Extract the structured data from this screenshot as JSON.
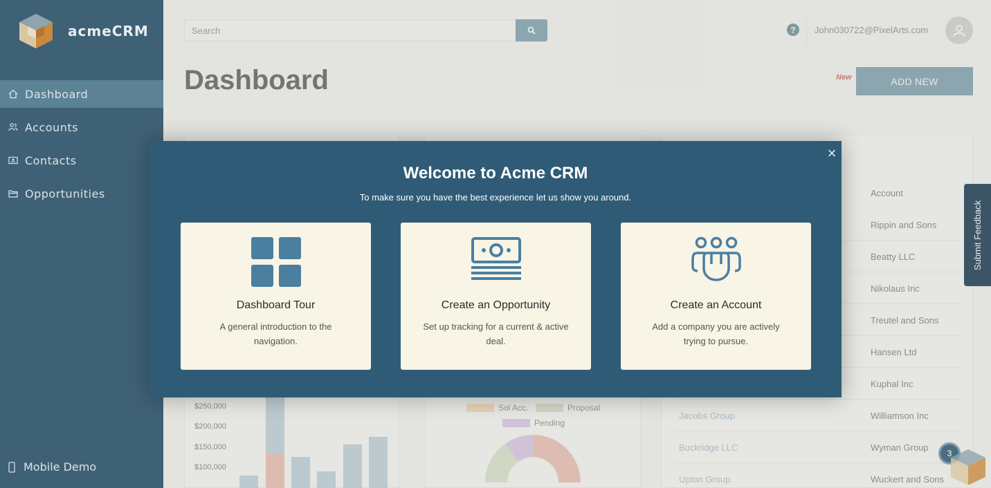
{
  "app": {
    "name": "acmeCRM"
  },
  "sidebar": {
    "items": [
      {
        "label": "Dashboard",
        "icon": "home-icon",
        "active": true
      },
      {
        "label": "Accounts",
        "icon": "users-icon",
        "active": false
      },
      {
        "label": "Contacts",
        "icon": "contact-card-icon",
        "active": false
      },
      {
        "label": "Opportunities",
        "icon": "folder-icon",
        "active": false
      }
    ],
    "mobile_demo": "Mobile Demo"
  },
  "topbar": {
    "search_placeholder": "Search",
    "user_email": "John030722@PixelArts.com",
    "help_icon": "?"
  },
  "header": {
    "title": "Dashboard",
    "new_badge": "New",
    "add_new_label": "ADD NEW"
  },
  "bar_chart": {
    "y_ticks": [
      "$250,000",
      "$200,000",
      "$150,000",
      "$100,000"
    ]
  },
  "pie_legend": [
    "Sol Acc.",
    "Proposal",
    "Pending"
  ],
  "table": {
    "header_right": "Account",
    "rows": [
      {
        "left": "",
        "right": "Rippin and Sons"
      },
      {
        "left": "",
        "right": "Beatty LLC"
      },
      {
        "left": "",
        "right": "Nikolaus Inc"
      },
      {
        "left": "",
        "right": "Treutel and Sons"
      },
      {
        "left": "",
        "right": "Hansen Ltd"
      },
      {
        "left": "",
        "right": "Kuphal Inc"
      },
      {
        "left": "Jacobs Group",
        "right": "Williamson Inc"
      },
      {
        "left": "Buckridge LLC",
        "right": "Wyman Group"
      },
      {
        "left": "Upton Group",
        "right": "Wuckert and Sons"
      }
    ]
  },
  "modal": {
    "title": "Welcome to Acme CRM",
    "subtitle": "To make sure you have the best experience let us show you around.",
    "close_glyph": "×",
    "cards": [
      {
        "title": "Dashboard Tour",
        "description": "A general introduction to the navigation.",
        "icon": "dashboard-grid-icon"
      },
      {
        "title": "Create an Opportunity",
        "description": "Set up tracking for a current & active deal.",
        "icon": "money-icon"
      },
      {
        "title": "Create an Account",
        "description": "Add a company you are actively trying to pursue.",
        "icon": "team-icon"
      }
    ]
  },
  "feedback": {
    "label": "Submit Feedback"
  },
  "notification": {
    "count": "3"
  },
  "colors": {
    "sidebar": "#3f6176",
    "modal": "#2f5b76",
    "accent": "#5f8697",
    "card": "#f8f4e6"
  }
}
